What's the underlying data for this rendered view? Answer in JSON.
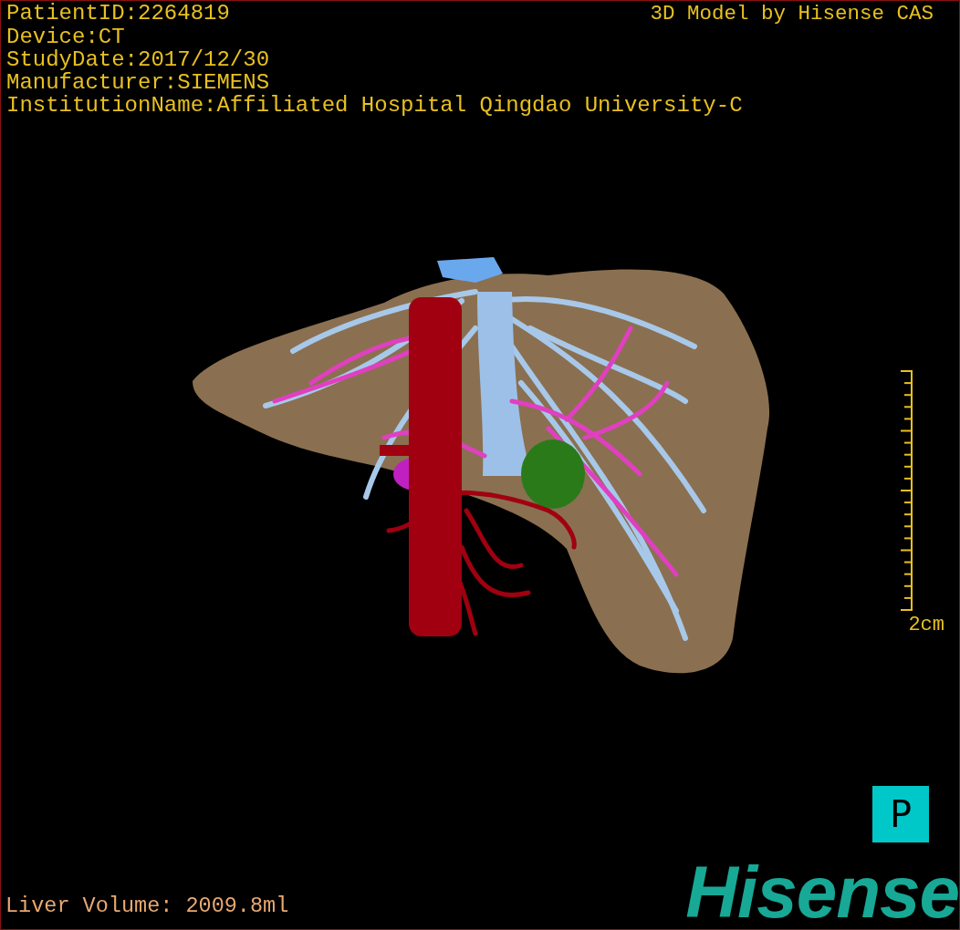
{
  "overlay": {
    "patient_info": [
      "PatientID:2264819",
      "Device:CT",
      "StudyDate:2017/12/30",
      "Manufacturer:SIEMENS",
      "InstitutionName:Affiliated Hospital Qingdao University-C"
    ],
    "title": "3D Model by Hisense CAS"
  },
  "scale": {
    "label": "2cm"
  },
  "orientation": {
    "label": "P"
  },
  "liver_volume": "Liver Volume: 2009.8ml",
  "logo": "Hisense"
}
